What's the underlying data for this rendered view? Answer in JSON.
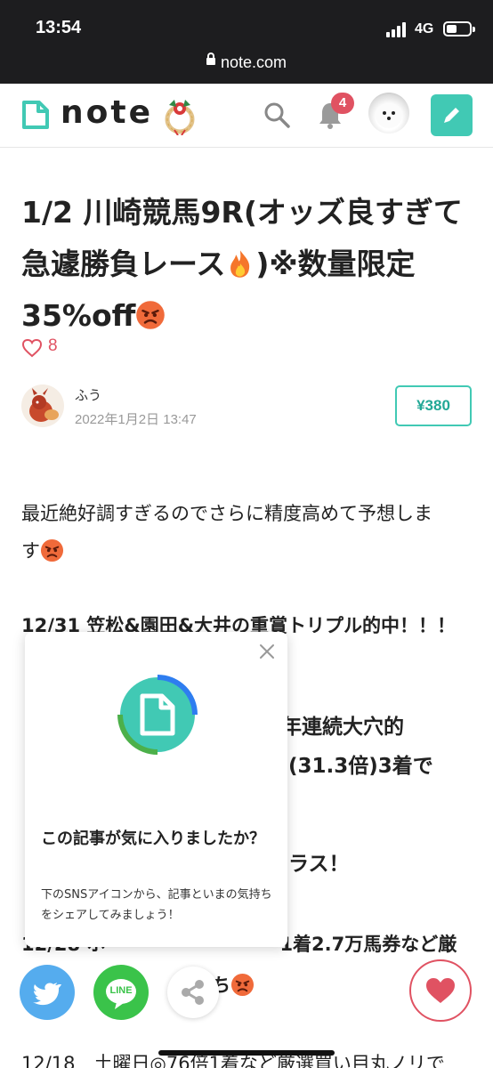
{
  "status_bar": {
    "time": "13:54",
    "network": "4G",
    "battery_percent": 45
  },
  "browser": {
    "url": "note.com"
  },
  "header": {
    "logo_text": "note",
    "notification_count": "4",
    "icons": [
      "note-logo-icon",
      "new-year-wreath-icon",
      "search-icon",
      "bell-icon",
      "avatar",
      "pen-icon"
    ],
    "accent_color": "#41c9b4",
    "badge_color": "#e05262"
  },
  "article": {
    "title_line1": "1/2 川崎競馬9R(オッズ良すぎて",
    "title_line2_a": "急遽勝負レース",
    "title_line2_b": ")※数量限定",
    "title_line3": "35%off",
    "like_count": "8",
    "author_name": "ふう",
    "date": "2022年1月2日 13:47",
    "price": "¥380",
    "paragraph1_a": "最近絶好調すぎるのでさらに精度高めて予想しま",
    "paragraph1_b": "す",
    "line_1231": "12/31 笠松&園田&大井の重賞トリプル的中！！！",
    "line_partial_a": "年連続大穴的",
    "line_partial_b": "(31.3倍)3着で",
    "line_partial_c": "ラス！",
    "line_1228_a": "12/28 ホ",
    "line_1228_b": "1着2.7万馬券など厳",
    "line_1228_c": "ち",
    "line_1218": "12/18　土曜日◎76倍1着など厳選買い目丸ノリで"
  },
  "popup": {
    "title": "この記事が気に入りましたか？",
    "description": "下のSNSアイコンから、記事といまの気持ちをシェアしてみましょう！"
  },
  "share": {
    "twitter_icon": "twitter-icon",
    "line_label": "LINE",
    "share_icon": "share-icon",
    "like_icon": "heart-icon",
    "twitter_color": "#55acee",
    "line_color": "#3ac34a",
    "like_color": "#e05262"
  }
}
